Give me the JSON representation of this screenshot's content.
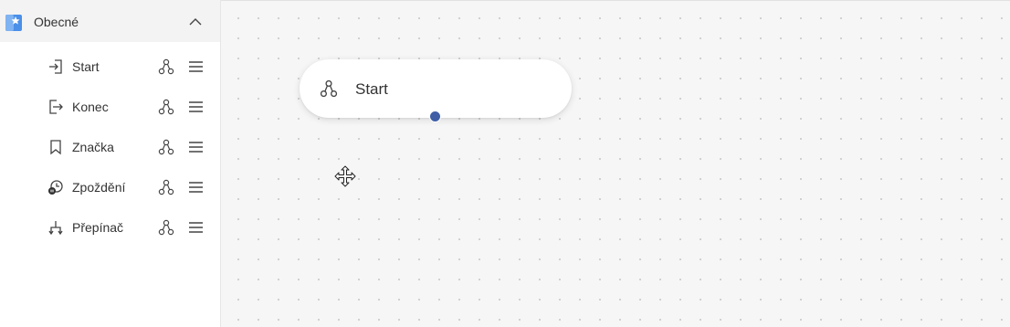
{
  "sidebar": {
    "group": {
      "title": "Obecné",
      "icon": "widget-group-icon",
      "collapse_icon": "chevron-up-icon",
      "accent_color": "#4a8fe8"
    },
    "items": [
      {
        "label": "Start",
        "icon": "sign-in-icon"
      },
      {
        "label": "Konec",
        "icon": "sign-out-icon"
      },
      {
        "label": "Značka",
        "icon": "bookmark-icon"
      },
      {
        "label": "Zpoždění",
        "icon": "delay-clock-icon"
      },
      {
        "label": "Přepínač",
        "icon": "switch-branch-icon"
      }
    ]
  },
  "canvas": {
    "node": {
      "label": "Start",
      "icon": "flow-nodes-icon",
      "port_color": "#3f5ea6"
    },
    "cursor": "move-cursor-icon"
  }
}
